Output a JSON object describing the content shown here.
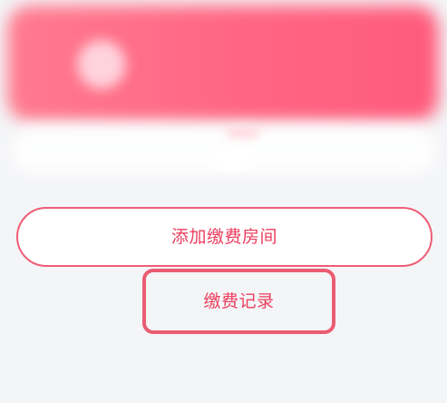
{
  "actions": {
    "add_room_label": "添加缴费房间",
    "records_label": "缴费记录"
  },
  "colors": {
    "accent": "#ec3f5f",
    "outline": "#ef5d76",
    "header_gradient_start": "#ff7a8f",
    "header_gradient_end": "#ff5b7c",
    "background": "#f4f5f7"
  }
}
